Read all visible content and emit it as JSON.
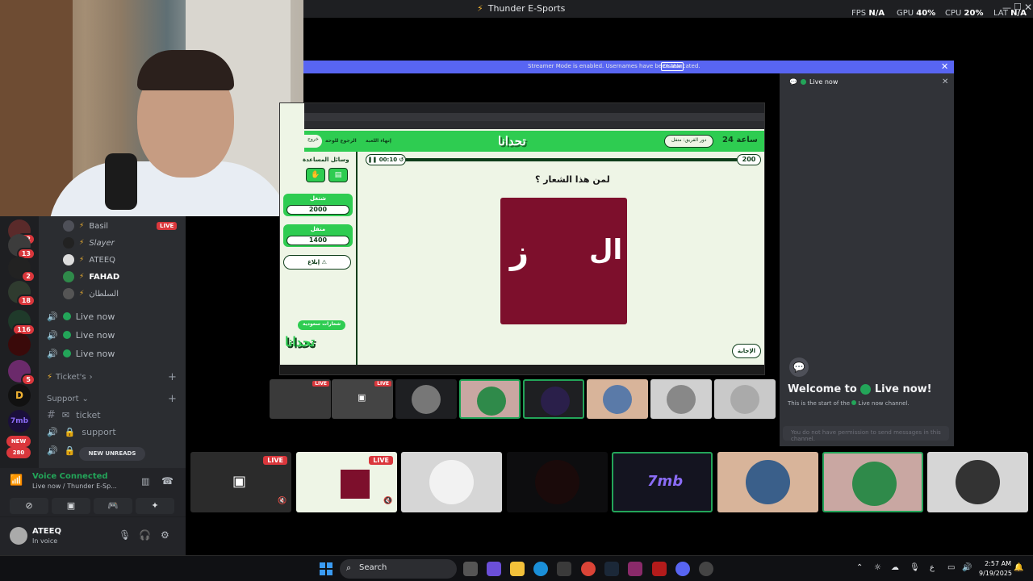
{
  "app": {
    "title": "Thunder E-Sports"
  },
  "stats": {
    "fps_label": "FPS",
    "fps": "N/A",
    "gpu_label": "GPU",
    "gpu": "40",
    "cpu_label": "CPU",
    "cpu": "20",
    "lat_label": "LAT",
    "lat": "N/A",
    "pct": "%"
  },
  "guild_badges": [
    "42",
    "13",
    "2",
    "18",
    "116",
    "5",
    "NEW",
    "280"
  ],
  "members": [
    {
      "name": "Basil",
      "live": "LIVE"
    },
    {
      "name": "Slayer"
    },
    {
      "name": "ATEEQ"
    },
    {
      "name": "FAHAD"
    },
    {
      "name": "السلطان"
    }
  ],
  "live_channels": [
    "Live now",
    "Live now",
    "Live now"
  ],
  "categories": {
    "tickets": "Ticket's",
    "support": "Support"
  },
  "text_channels": [
    "ticket",
    "support"
  ],
  "new_unreads": "NEW UNREADS",
  "voice": {
    "title": "Voice Connected",
    "subtitle": "Live now / Thunder E-Sp..."
  },
  "user": {
    "name": "ATEEQ",
    "status": "In voice"
  },
  "stream_banner": {
    "text": "Streamer Mode is enabled. Usernames have been truncated.",
    "button": "Disable"
  },
  "chat": {
    "header": "Live now",
    "welcome": "Welcome to",
    "welcome_channel": "Live now!",
    "start_text": "This is the start of the",
    "start_channel": "Live now",
    "start_suffix": "channel.",
    "no_permission": "You do not have permission to send messages in this channel."
  },
  "game": {
    "logo": "تحدانا",
    "hours": "24 ساعة",
    "turn": "دور الفريق: متفل",
    "back": "الرجوع للوحة",
    "end": "إنهاء اللعبة",
    "exit": "خروج",
    "timer": "00:10",
    "points": "200",
    "question": "لمن هذا الشعار ؟",
    "logo_left": "ز",
    "logo_right": "ال",
    "aids_title": "وسائل المساعدة",
    "team1_name": "شتغل",
    "team1_score": "2000",
    "team2_name": "متفل",
    "team2_score": "1400",
    "report": "إبلاغ",
    "category": "شعارات سعودية",
    "answer": "الإجابة"
  },
  "taskbar": {
    "search": "Search",
    "time": "2:57 AM",
    "date": "9/19/2025",
    "lang": "ع"
  },
  "tile_live": "LIVE",
  "tile_brand": "7mb"
}
